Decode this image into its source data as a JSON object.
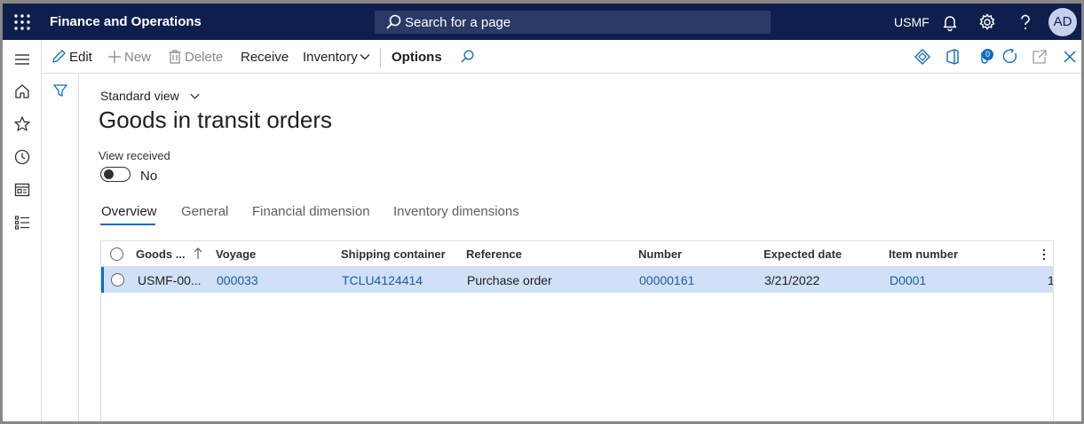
{
  "app": {
    "title": "Finance and Operations",
    "search_placeholder": "Search for a page",
    "company": "USMF",
    "user_initials": "AD"
  },
  "actions": {
    "edit": "Edit",
    "new": "New",
    "delete": "Delete",
    "receive": "Receive",
    "inventory": "Inventory",
    "options": "Options",
    "attachments_count": "0"
  },
  "page": {
    "view": "Standard view",
    "title": "Goods in transit orders",
    "view_received_label": "View received",
    "view_received_value": "No"
  },
  "tabs": [
    "Overview",
    "General",
    "Financial dimension",
    "Inventory dimensions"
  ],
  "grid": {
    "columns": [
      "Goods ...",
      "Voyage",
      "Shipping container",
      "Reference",
      "Number",
      "Expected date",
      "Item number"
    ],
    "rows": [
      {
        "goods": "USMF-00...",
        "voyage": "000033",
        "container": "TCLU4124414",
        "reference": "Purchase order",
        "number": "00000161",
        "expected_date": "3/21/2022",
        "item_number": "D0001",
        "overflow": "1"
      }
    ]
  },
  "colors": {
    "nav": "#0f1f4d",
    "accent": "#0f6cbd",
    "selected_row": "#cfe0f8",
    "link": "#1e5aa8"
  }
}
